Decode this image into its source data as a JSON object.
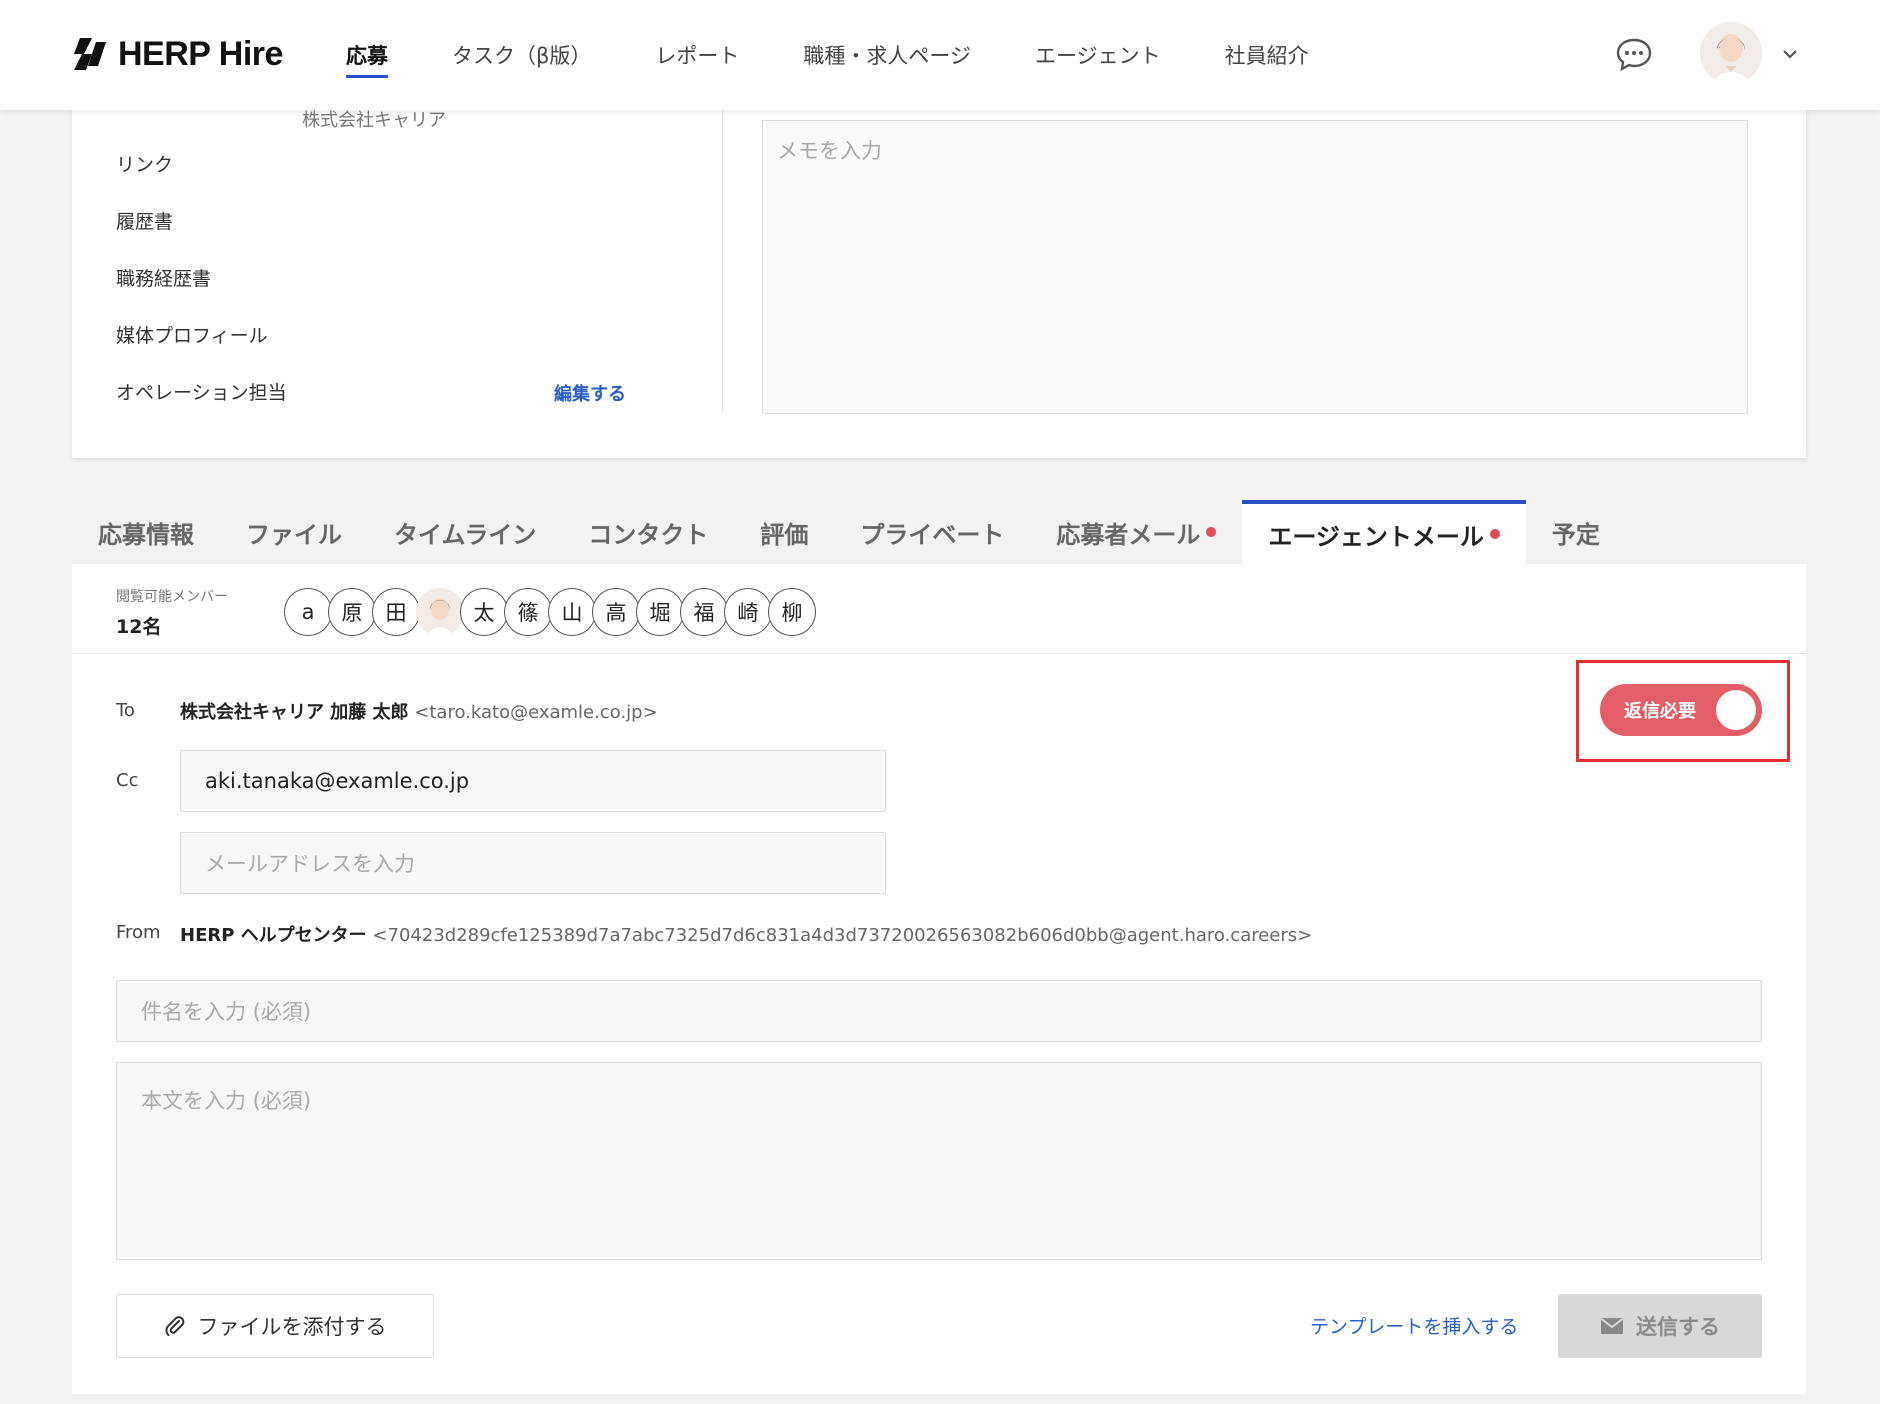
{
  "app": {
    "logo_text": "HERP Hire"
  },
  "nav": {
    "items": [
      {
        "label": "応募",
        "active": true
      },
      {
        "label": "タスク（β版）",
        "active": false
      },
      {
        "label": "レポート",
        "active": false
      },
      {
        "label": "職種・求人ページ",
        "active": false
      },
      {
        "label": "エージェント",
        "active": false
      },
      {
        "label": "社員紹介",
        "active": false
      }
    ],
    "icons": [
      "chat-bubble-icon",
      "avatar",
      "chevron-down-icon"
    ]
  },
  "upper": {
    "partial_text": "株式会社キャリア",
    "side_items": [
      "リンク",
      "履歴書",
      "職務経歴書",
      "媒体プロフィール",
      "オペレーション担当"
    ],
    "edit_link": "編集する",
    "memo_placeholder": "メモを入力"
  },
  "tabs": [
    {
      "label": "応募情報",
      "dot": false,
      "active": false
    },
    {
      "label": "ファイル",
      "dot": false,
      "active": false
    },
    {
      "label": "タイムライン",
      "dot": false,
      "active": false
    },
    {
      "label": "コンタクト",
      "dot": false,
      "active": false
    },
    {
      "label": "評価",
      "dot": false,
      "active": false
    },
    {
      "label": "プライベート",
      "dot": false,
      "active": false
    },
    {
      "label": "応募者メール",
      "dot": true,
      "active": false
    },
    {
      "label": "エージェントメール",
      "dot": true,
      "active": true
    },
    {
      "label": "予定",
      "dot": false,
      "active": false
    }
  ],
  "members": {
    "label": "閲覧可能メンバー",
    "count": "12名",
    "chips": [
      "a",
      "原",
      "田",
      "",
      "太",
      "篠",
      "山",
      "高",
      "堀",
      "福",
      "崎",
      "柳"
    ]
  },
  "mail": {
    "to_label": "To",
    "to_name": "株式会社キャリア 加藤 太郎",
    "to_addr": "<taro.kato@examle.co.jp>",
    "cc_label": "Cc",
    "cc_value": "aki.tanaka@examle.co.jp",
    "cc_placeholder": "メールアドレスを入力",
    "from_label": "From",
    "from_name": "HERP ヘルプセンター",
    "from_addr": "<70423d289cfe125389d7a7abc7325d7d6c831a4d3d73720026563082b606d0bb@agent.haro.careers>",
    "subject_placeholder": "件名を入力 (必須)",
    "body_placeholder": "本文を入力 (必須)",
    "reply_toggle_label": "返信必要",
    "reply_toggle_on": true,
    "attach_label": "ファイルを添付する",
    "template_label": "テンプレートを挿入する",
    "send_label": "送信する"
  },
  "colors": {
    "accent": "#2a4fc4",
    "link": "#2a5fc4",
    "alert_dot": "#e04a59",
    "toggle": "#e35e66",
    "highlight": "#e23030"
  }
}
